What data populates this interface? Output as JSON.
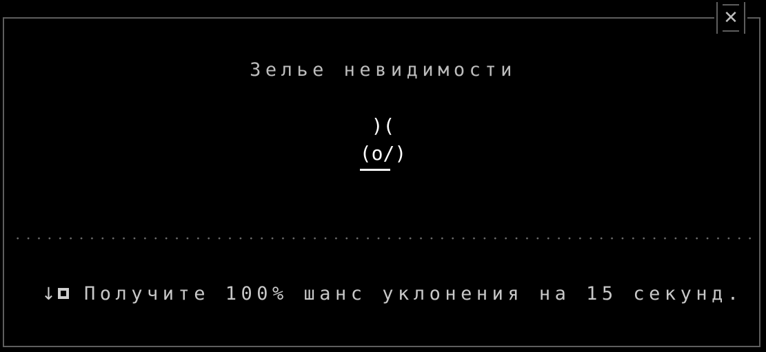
{
  "dialog": {
    "close_label": "✕",
    "title": "Зелье невидимости",
    "art_lines": [
      ")(",
      "(o/)"
    ],
    "effect_icons": [
      "down-arrow-icon",
      "stat-box-icon"
    ],
    "description": "Получите 100% шанс уклонения на 15 секунд."
  },
  "colors": {
    "background": "#000000",
    "border": "#5e5e5e",
    "text": "#c8c8c8",
    "art": "#ffffff"
  }
}
